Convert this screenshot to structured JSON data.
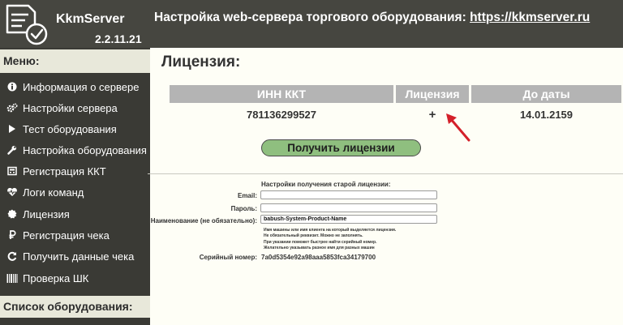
{
  "header": {
    "app_name": "KkmServer",
    "version": "2.2.11.21",
    "title_prefix": "Настройка web-сервера торгового оборудования: ",
    "title_link": "https://kkmserver.ru"
  },
  "sidebar": {
    "menu_header": "Меню:",
    "items": [
      {
        "label": "Информация о сервере",
        "icon": "info-icon"
      },
      {
        "label": "Настройки сервера",
        "icon": "gears-icon"
      },
      {
        "label": "Тест оборудования",
        "icon": "play-icon"
      },
      {
        "label": "Настройка оборудования",
        "icon": "wrench-icon"
      },
      {
        "label": "Регистрация ККТ",
        "icon": "register-icon"
      },
      {
        "label": "Логи команд",
        "icon": "heartbeat-icon"
      },
      {
        "label": "Лицензия",
        "icon": "badge-icon"
      },
      {
        "label": "Регистрация чека",
        "icon": "ruble-icon"
      },
      {
        "label": "Получить данные чека",
        "icon": "refresh-icon"
      },
      {
        "label": "Проверка ШК",
        "icon": "barcode-icon"
      }
    ],
    "equipment_header": "Список оборудования:"
  },
  "main": {
    "page_title": "Лицензия:",
    "table": {
      "headers": [
        "ИНН ККТ",
        "Лицензия",
        "До даты"
      ],
      "rows": [
        [
          "781136299527",
          "+",
          "14.01.2159"
        ]
      ]
    },
    "get_license_button": "Получить лицензии",
    "old_license": {
      "title": "Настройки получения старой лицензии:",
      "email_label": "Email:",
      "email_value": "",
      "password_label": "Пароль:",
      "password_value": "",
      "name_label": "Наименование (не обязательно):",
      "name_value": "babush-System-Product-Name",
      "hints": [
        "Имя машины или имя клиента на который выделяется лицензия.",
        "Не обязательный реквизит. Можно не заполнять.",
        "При указании поможет быстрее найти серийный номер.",
        "Желательно указывать разное имя для разных машин"
      ],
      "serial_label": "Серийный номер:",
      "serial_value": "7a0d5354e92a98aaa5853fca34179700"
    }
  },
  "colors": {
    "header_bg": "#464640",
    "sidebar_bg": "#3a3a35",
    "panel_header_bg": "#e8e8da",
    "table_header_bg": "#b4b4b4",
    "button_bg": "#8fbf7f",
    "arrow": "#d4202a"
  }
}
